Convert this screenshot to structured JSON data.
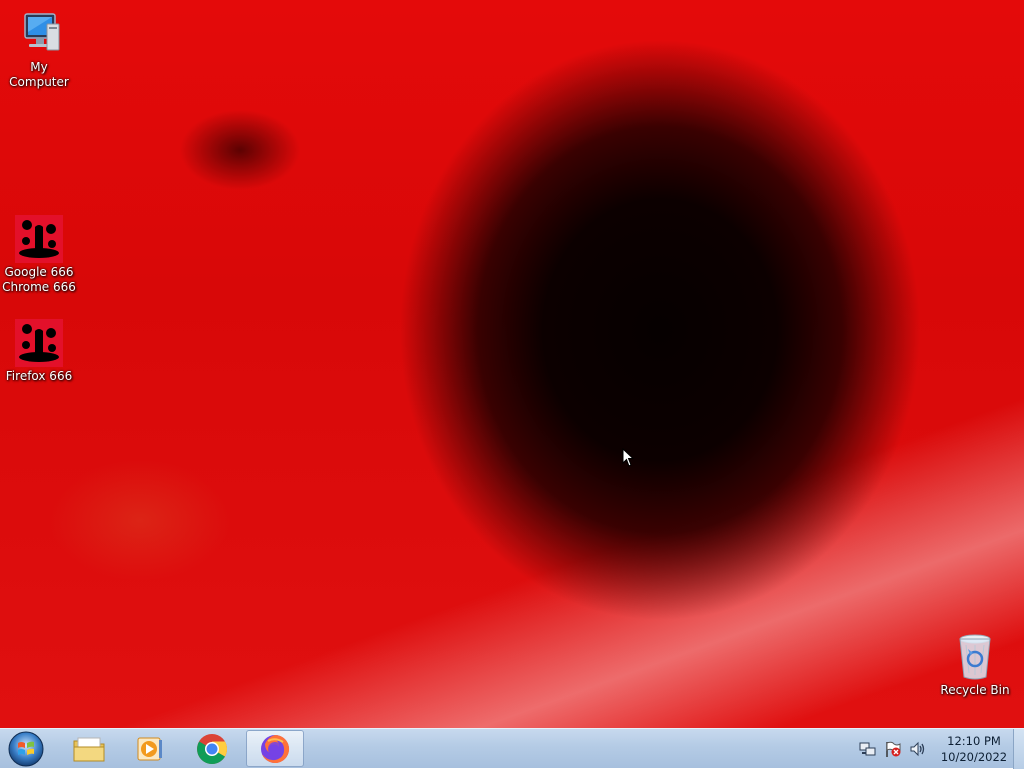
{
  "desktop": {
    "icons": [
      {
        "label": "My Computer",
        "icon": "computer-icon"
      },
      {
        "label": "Google 666 Chrome 666",
        "icon": "spooky-figures-icon"
      },
      {
        "label": "Firefox 666",
        "icon": "spooky-figures-icon"
      },
      {
        "label": "Recycle Bin",
        "icon": "recycle-bin-icon"
      }
    ]
  },
  "taskbar": {
    "start_icon": "windows-orb-icon",
    "pinned": [
      {
        "name": "Windows Explorer",
        "icon": "folder-icon"
      },
      {
        "name": "Windows Media Player",
        "icon": "media-player-icon"
      },
      {
        "name": "Google Chrome",
        "icon": "chrome-icon"
      },
      {
        "name": "Firefox",
        "icon": "firefox-icon",
        "active": true
      }
    ],
    "tray": {
      "icons": [
        "network-icon",
        "action-center-flag-icon",
        "volume-icon"
      ],
      "time": "12:10 PM",
      "date": "10/20/2022"
    }
  },
  "colors": {
    "wallpaper_red": "#e00a0a",
    "taskbar_blue": "#b4cbe5"
  }
}
